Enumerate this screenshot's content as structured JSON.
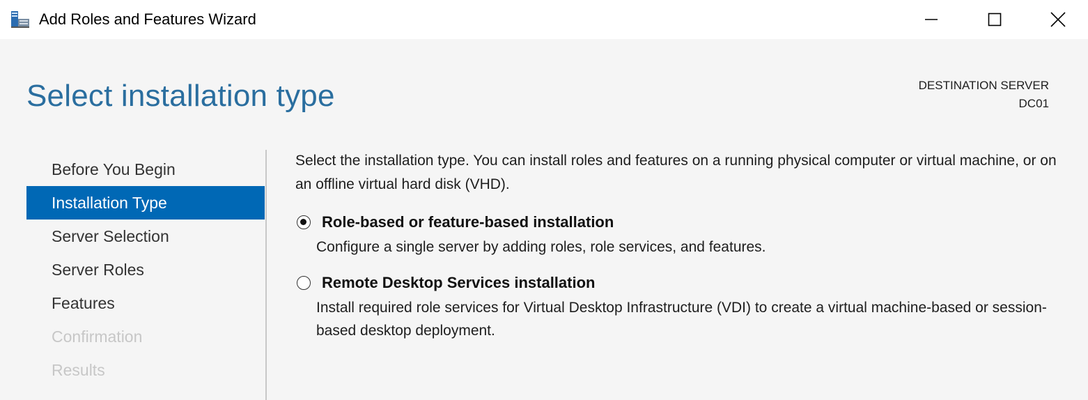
{
  "window": {
    "title": "Add Roles and Features Wizard",
    "icon": "server-manager-icon",
    "controls": [
      "minimize-icon",
      "maximize-icon",
      "close-icon"
    ]
  },
  "header": {
    "page_title": "Select installation type",
    "destination_label": "DESTINATION SERVER",
    "destination_server": "DC01"
  },
  "nav": {
    "items": [
      {
        "label": "Before You Begin",
        "state": "normal"
      },
      {
        "label": "Installation Type",
        "state": "active"
      },
      {
        "label": "Server Selection",
        "state": "normal"
      },
      {
        "label": "Server Roles",
        "state": "normal"
      },
      {
        "label": "Features",
        "state": "normal"
      },
      {
        "label": "Confirmation",
        "state": "disabled"
      },
      {
        "label": "Results",
        "state": "disabled"
      }
    ]
  },
  "main": {
    "intro": "Select the installation type. You can install roles and features on a running physical computer or virtual machine, or on an offline virtual hard disk (VHD).",
    "options": [
      {
        "label": "Role-based or feature-based installation",
        "description": "Configure a single server by adding roles, role services, and features.",
        "selected": true
      },
      {
        "label": "Remote Desktop Services installation",
        "description": "Install required role services for Virtual Desktop Infrastructure (VDI) to create a virtual machine-based or session-based desktop deployment.",
        "selected": false
      }
    ]
  },
  "colors": {
    "accent": "#0068b5",
    "title": "#2a6e9f",
    "disabled_text": "#c7c7c7"
  }
}
